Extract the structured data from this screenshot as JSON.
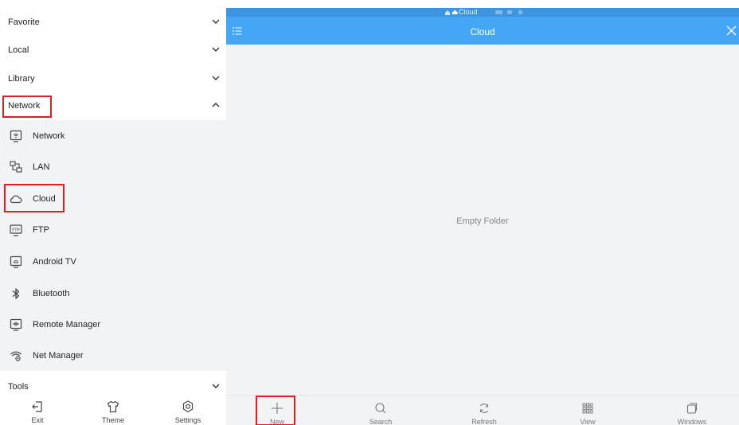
{
  "sidebar": {
    "sections": [
      {
        "label": "Favorite",
        "expanded": false
      },
      {
        "label": "Local",
        "expanded": false
      },
      {
        "label": "Library",
        "expanded": false
      },
      {
        "label": "Network",
        "expanded": true
      },
      {
        "label": "Tools",
        "expanded": false
      }
    ],
    "network_items": [
      {
        "label": "Network",
        "icon": "network-icon"
      },
      {
        "label": "LAN",
        "icon": "lan-icon"
      },
      {
        "label": "Cloud",
        "icon": "cloud-icon"
      },
      {
        "label": "FTP",
        "icon": "ftp-icon"
      },
      {
        "label": "Android TV",
        "icon": "android-tv-icon"
      },
      {
        "label": "Bluetooth",
        "icon": "bluetooth-icon"
      },
      {
        "label": "Remote Manager",
        "icon": "remote-manager-icon"
      },
      {
        "label": "Net Manager",
        "icon": "net-manager-icon"
      }
    ],
    "bottom": [
      {
        "label": "Exit",
        "icon": "exit-icon"
      },
      {
        "label": "Theme",
        "icon": "theme-icon"
      },
      {
        "label": "Settings",
        "icon": "settings-icon"
      }
    ]
  },
  "main": {
    "breadcrumb": "Cloud",
    "title": "Cloud",
    "empty_text": "Empty Folder",
    "toolbar": [
      {
        "label": "New",
        "icon": "plus-icon"
      },
      {
        "label": "Search",
        "icon": "search-icon"
      },
      {
        "label": "Refresh",
        "icon": "refresh-icon"
      },
      {
        "label": "View",
        "icon": "grid-view-icon"
      },
      {
        "label": "Windows",
        "icon": "windows-icon"
      }
    ]
  },
  "colors": {
    "title_bar": "#45a6f5",
    "status_strip": "#3f94e0",
    "highlight": "#e02020",
    "panel_bg": "#f2f3f5"
  }
}
